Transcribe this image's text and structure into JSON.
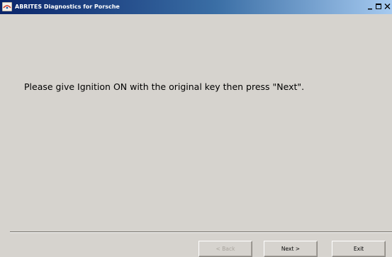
{
  "window": {
    "title": "ABRITES Diagnostics for Porsche",
    "controls": {
      "minimize": "_",
      "maximize": "□",
      "close": "X"
    }
  },
  "main": {
    "message": "Please give Ignition ON with the original key then press \"Next\"."
  },
  "footer": {
    "back_label": "< Back",
    "next_label": "Next >",
    "exit_label": "Exit"
  },
  "colors": {
    "title_bar_start": "#0a246a",
    "title_bar_end": "#a6caf0",
    "window_background": "#d6d3ce",
    "disabled_text": "#a8a49d"
  }
}
